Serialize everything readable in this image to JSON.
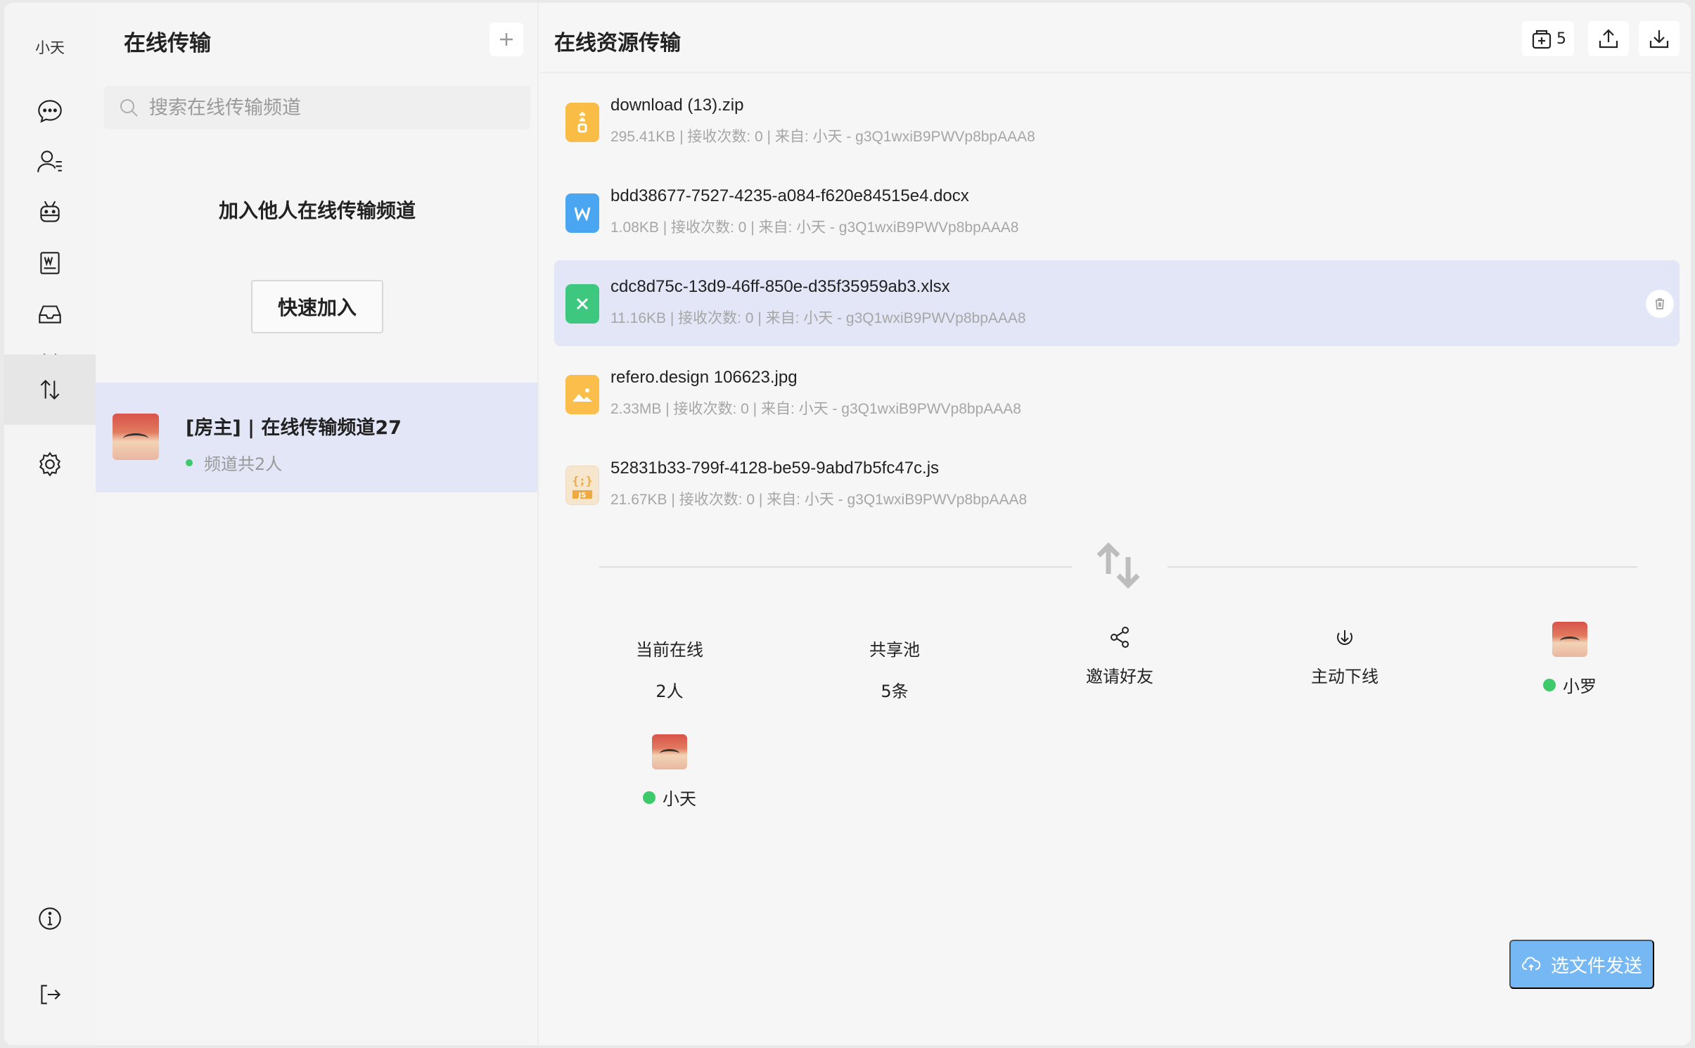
{
  "rail": {
    "user": "小天",
    "items": [
      {
        "icon": "chat-icon"
      },
      {
        "icon": "contacts-icon"
      },
      {
        "icon": "robot-icon"
      },
      {
        "icon": "word-doc-icon"
      },
      {
        "icon": "inbox-icon"
      },
      {
        "icon": "scissors-icon"
      },
      {
        "icon": "transfer-icon",
        "active": true
      },
      {
        "icon": "settings-icon"
      },
      {
        "icon": "info-icon"
      },
      {
        "icon": "logout-icon"
      }
    ]
  },
  "channels": {
    "title": "在线传输",
    "search_placeholder": "搜索在线传输频道",
    "join_title": "加入他人在线传输频道",
    "quick_join_label": "快速加入",
    "items": [
      {
        "name": "[房主] | 在线传输频道27",
        "meta": "频道共2人"
      }
    ]
  },
  "main": {
    "title": "在线资源传输",
    "header_count": "5",
    "files": [
      {
        "name": "download (13).zip",
        "meta": "295.41KB | 接收次数: 0 | 来自: 小天 - g3Q1wxiB9PWVp8bpAAA8",
        "type": "zip"
      },
      {
        "name": "bdd38677-7527-4235-a084-f620e84515e4.docx",
        "meta": "1.08KB | 接收次数: 0 | 来自: 小天 - g3Q1wxiB9PWVp8bpAAA8",
        "type": "docx"
      },
      {
        "name": "cdc8d75c-13d9-46ff-850e-d35f35959ab3.xlsx",
        "meta": "11.16KB | 接收次数: 0 | 来自: 小天 - g3Q1wxiB9PWVp8bpAAA8",
        "type": "xlsx",
        "selected": true
      },
      {
        "name": "refero.design 106623.jpg",
        "meta": "2.33MB | 接收次数: 0 | 来自: 小天 - g3Q1wxiB9PWVp8bpAAA8",
        "type": "jpg"
      },
      {
        "name": "52831b33-799f-4128-be59-9abd7b5fc47c.js",
        "meta": "21.67KB | 接收次数: 0 | 来自: 小天 - g3Q1wxiB9PWVp8bpAAA8",
        "type": "js"
      }
    ],
    "stats": {
      "online_label": "当前在线",
      "online_value": "2人",
      "pool_label": "共享池",
      "pool_value": "5条",
      "invite_label": "邀请好友",
      "offline_label": "主动下线"
    },
    "members": [
      {
        "name": "小罗"
      },
      {
        "name": "小天"
      }
    ],
    "send_label": "选文件发送"
  },
  "colors": {
    "zip": "#f9bd45",
    "docx": "#4aa6f0",
    "xlsx": "#3ec77f",
    "jpg": "#fbbe4a",
    "js": "#f5e6cd",
    "online_dot": "#3ec96b",
    "selected_bg": "#e3e6f6",
    "send_btn": "#75b8f3"
  }
}
